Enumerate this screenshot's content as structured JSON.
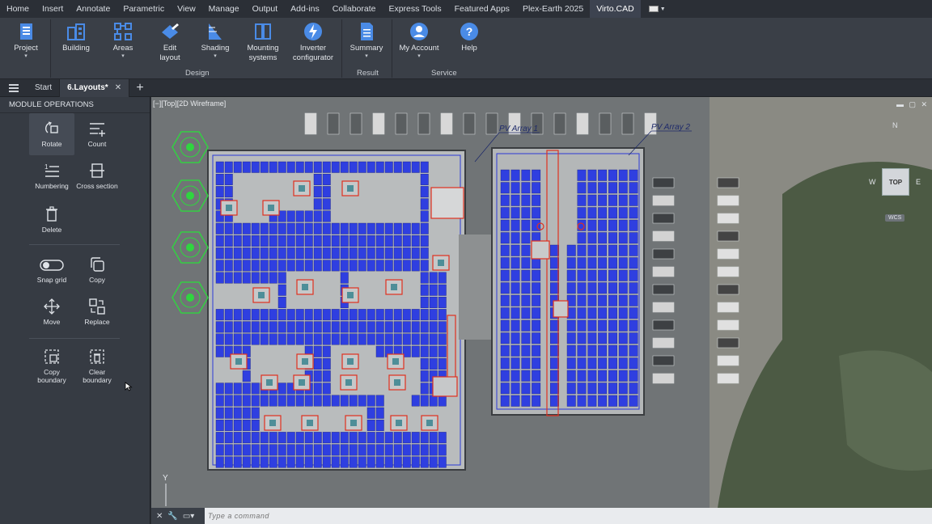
{
  "menubar": {
    "items": [
      "Home",
      "Insert",
      "Annotate",
      "Parametric",
      "View",
      "Manage",
      "Output",
      "Add-ins",
      "Collaborate",
      "Express Tools",
      "Featured Apps",
      "Plex-Earth 2025",
      "Virto.CAD"
    ]
  },
  "ribbon": {
    "buttons": {
      "project": "Project",
      "building": "Building",
      "areas": "Areas",
      "edit_layout_1": "Edit",
      "edit_layout_2": "layout",
      "shading": "Shading",
      "mounting_1": "Mounting",
      "mounting_2": "systems",
      "inverter_1": "Inverter",
      "inverter_2": "configurator",
      "summary": "Summary",
      "my_account": "My Account",
      "help": "Help"
    },
    "groups": {
      "design": "Design",
      "result": "Result",
      "service": "Service"
    }
  },
  "tabs": {
    "start": "Start",
    "layouts": "6.Layouts*",
    "close": "✕",
    "add": "+"
  },
  "panel": {
    "title": "MODULE OPERATIONS",
    "ops": {
      "rotate": "Rotate",
      "count": "Count",
      "numbering": "Numbering",
      "cross_section": "Cross section",
      "delete": "Delete",
      "snap_grid": "Snap grid",
      "copy": "Copy",
      "move": "Move",
      "replace": "Replace",
      "copy_boundary_1": "Copy",
      "copy_boundary_2": "boundary",
      "clear_boundary_1": "Clear",
      "clear_boundary_2": "boundary"
    }
  },
  "viewport": {
    "label": "[−][Top][2D Wireframe]",
    "array1": "PV Array 1",
    "array2": "PV Array 2",
    "viewcube": {
      "n": "N",
      "w": "W",
      "e": "E",
      "top": "TOP",
      "wcs": "WCS"
    },
    "y_axis": "Y"
  },
  "command": {
    "placeholder": "Type a command"
  },
  "colors": {
    "module_blue": "#2f3fe0",
    "boundary_red": "#e0301e",
    "tree_green": "#2fd63f",
    "ribbon_bg": "#3a3f47"
  }
}
